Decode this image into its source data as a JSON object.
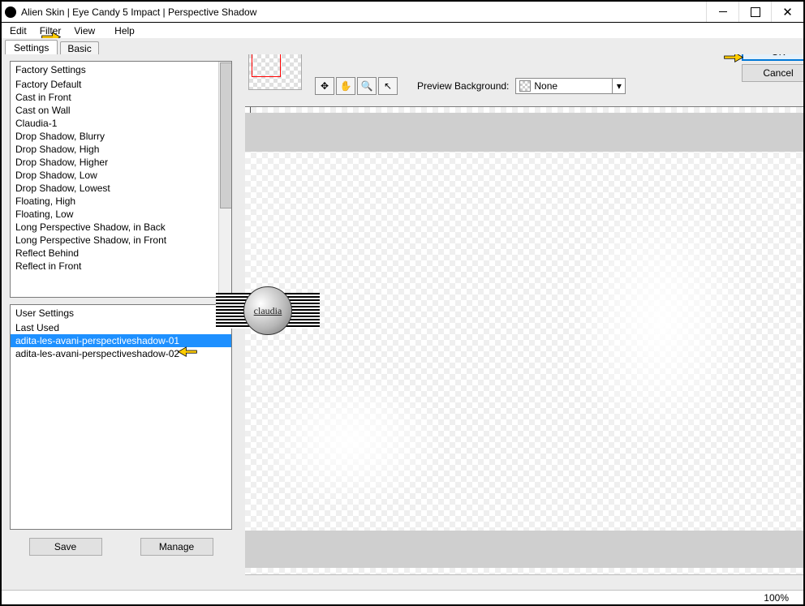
{
  "window": {
    "title": "Alien Skin | Eye Candy 5 Impact | Perspective Shadow"
  },
  "menu": {
    "edit": "Edit",
    "filter": "Filter",
    "view": "View",
    "help": "Help"
  },
  "tabs": {
    "settings": "Settings",
    "basic": "Basic"
  },
  "factory": {
    "header": "Factory Settings",
    "items": [
      "Factory Default",
      "Cast in Front",
      "Cast on Wall",
      "Claudia-1",
      "Drop Shadow, Blurry",
      "Drop Shadow, High",
      "Drop Shadow, Higher",
      "Drop Shadow, Low",
      "Drop Shadow, Lowest",
      "Floating, High",
      "Floating, Low",
      "Long Perspective Shadow, in Back",
      "Long Perspective Shadow, in Front",
      "Reflect Behind",
      "Reflect in Front"
    ]
  },
  "user": {
    "header": "User Settings",
    "items": [
      {
        "label": "Last Used",
        "selected": false
      },
      {
        "label": "adita-les-avani-perspectiveshadow-01",
        "selected": true
      },
      {
        "label": "adita-les-avani-perspectiveshadow-02",
        "selected": false
      }
    ]
  },
  "buttons": {
    "save": "Save",
    "manage": "Manage",
    "ok": "OK",
    "cancel": "Cancel"
  },
  "previewbg": {
    "label": "Preview Background:",
    "value": "None"
  },
  "badge": {
    "text": "claudia"
  },
  "status": {
    "zoom": "100%"
  }
}
